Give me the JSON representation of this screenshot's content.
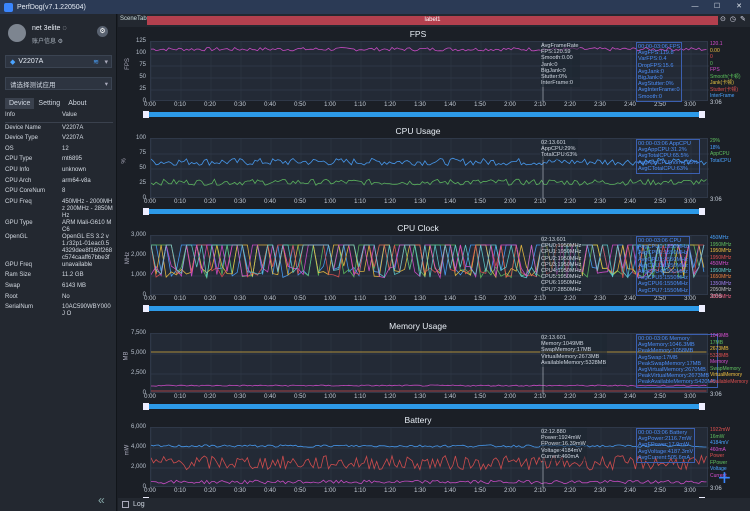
{
  "app": {
    "title": "PerfDog(v7.1.220504)",
    "window_controls": [
      "—",
      "☐",
      "✕"
    ]
  },
  "user": {
    "name": "net 3elite ◌",
    "info": "账户信息 ⚙"
  },
  "device": {
    "selected": "V2207A",
    "wifi_icon": "wifi-icon"
  },
  "app_select": {
    "placeholder": "请选择测试应用"
  },
  "tabs": [
    "Device",
    "Setting",
    "About"
  ],
  "info_table": {
    "header": [
      "Info",
      "Value"
    ],
    "rows": [
      [
        "Device Name",
        "V2207A"
      ],
      [
        "Device Type",
        "V2207A"
      ],
      [
        "OS",
        "12"
      ],
      [
        "CPU Type",
        "mt6895"
      ],
      [
        "CPU Info",
        "unknown"
      ],
      [
        "CPU Arch",
        "arm64-v8a"
      ],
      [
        "CPU CoreNum",
        "8"
      ],
      [
        "CPU Freq",
        "450MHz - 2000MHz 200MHz - 2850MHz"
      ],
      [
        "GPU Type",
        "ARM Mali-G610 MC6"
      ],
      [
        "OpenGL",
        "OpenGL ES 3.2 v1.r32p1-01eac0.5 4329dee8f160f268 c574caaff67bbe3f"
      ],
      [
        "GPU Freq",
        "unavailable"
      ],
      [
        "Ram Size",
        "11.2 GB"
      ],
      [
        "Swap",
        "6143 MB"
      ],
      [
        "Root",
        "No"
      ],
      [
        "SerialNum",
        "10AC590WBY000J O"
      ]
    ]
  },
  "scene": {
    "tab": "SceneTab",
    "label": "label1"
  },
  "x_ticks": [
    "0:00",
    "0:10",
    "0:20",
    "0:30",
    "0:40",
    "0:50",
    "1:00",
    "1:10",
    "1:20",
    "1:30",
    "1:40",
    "1:50",
    "2:00",
    "2:10",
    "2:20",
    "2:30",
    "2:40",
    "2:50",
    "3:00"
  ],
  "end_time": "3:06",
  "log_label": "Log",
  "panels": [
    {
      "title": "FPS",
      "ylabel": "FPS",
      "yticks": [
        "125",
        "100",
        "75",
        "50",
        "25",
        "0"
      ],
      "stat": [
        "AvgFrameRate",
        "FPS:120.59",
        "Smooth:0.00",
        "Jank:0",
        "BigJank:0",
        "Stutter:0%",
        "InterFrame:0"
      ],
      "stat2": [
        "00:00-03:06 FPS",
        "AvgFPS:119.8",
        "VarFPS:0.4",
        "DropFPS:15.6",
        "AvgJank:0",
        "BigJank:0",
        "AvgStutter:0%",
        "AvgInterFrame:0",
        "Smooth:0"
      ],
      "legend": [
        [
          "120.1",
          "#d74fd0"
        ],
        [
          "0.00",
          "#f0c040"
        ],
        [
          "0",
          "#e05050"
        ],
        [
          "0",
          "#60c060"
        ],
        [
          "FPS",
          "#d74fd0"
        ],
        [
          "Smooth(卡顿)",
          "#5ac05a"
        ],
        [
          "Jank(卡顿)",
          "#e0c040"
        ],
        [
          "Stutter(卡顿)",
          "#e05050"
        ],
        [
          "InterFrame",
          "#4aa3ff"
        ]
      ]
    },
    {
      "title": "CPU Usage",
      "ylabel": "%",
      "yticks": [
        "100",
        "75",
        "50",
        "25",
        "0"
      ],
      "stat": [
        "02:13.601",
        "AppCPU:29%",
        "TotalCPU:63%"
      ],
      "stat2": [
        "00:00-03:06 AppCPU",
        "AvgAppCPU:31.2%",
        "AvgTotalCPU:65.5%",
        "AvgAppCPU[norm]:25%",
        "AvgCTotalCPU:63%"
      ],
      "legend": [
        [
          "29%",
          "#60c060"
        ],
        [
          "18%",
          "#4aa3ff"
        ],
        [
          "AppCPU",
          "#60c060"
        ],
        [
          "TotalCPU",
          "#4aa3ff"
        ]
      ]
    },
    {
      "title": "CPU Clock",
      "ylabel": "MHz",
      "yticks": [
        "3,000",
        "2,000",
        "1,000",
        "0"
      ],
      "stat": [
        "02:13.601",
        "CPU0:1950MHz",
        "CPU1:1950MHz",
        "CPU2:1950MHz",
        "CPU3:1950MHz",
        "CPU4:1950MHz",
        "CPU5:1950MHz",
        "CPU6:1950MHz",
        "CPU7:2850MHz"
      ],
      "stat2": [
        "00:00-03:06 CPU",
        "AvgCPU0:1550MHz",
        "AvgCPU1:1550MHz",
        "AvgCPU2:1550MHz",
        "AvgCPU3:1550MHz",
        "AvgCPU4:1550MHz",
        "AvgCPU5:1550MHz",
        "AvgCPU6:1550MHz",
        "AvgCPU7:1550MHz"
      ],
      "legend": [
        [
          "450MHz",
          "#4aa3ff"
        ],
        [
          "1950MHz",
          "#60c060"
        ],
        [
          "1950MHz",
          "#f0c040"
        ],
        [
          "1950MHz",
          "#e05050"
        ],
        [
          "450MHz",
          "#d74fd0"
        ],
        [
          "1950MHz",
          "#60d0d0"
        ],
        [
          "1650MHz",
          "#f08040"
        ],
        [
          "1350MHz",
          "#a080f0"
        ],
        [
          "2050MHz",
          "#c0c0c0"
        ],
        [
          "2850MHz",
          "#f06080"
        ]
      ]
    },
    {
      "title": "Memory Usage",
      "ylabel": "MB",
      "yticks": [
        "7,500",
        "5,000",
        "2,500",
        "0"
      ],
      "stat": [
        "02:13.601",
        "Memory:1049MB",
        "SwapMemory:17MB",
        "VirtualMemory:2673MB",
        "AvailableMemory:5328MB"
      ],
      "stat2": [
        "00:00-03:06 Memory",
        "AvgMemory:1046.3MB",
        "PeakMemory:1058MB",
        "AvgSwap:17MB",
        "PeakSwapMemory:17MB",
        "AvgVirtualMemory:2670MB",
        "PeakVirtualMemory:2673MB",
        "PeakAvailableMemory:5420MB"
      ],
      "legend": [
        [
          "1049MB",
          "#d74fd0"
        ],
        [
          "17MB",
          "#60c060"
        ],
        [
          "2673MB",
          "#f0c040"
        ],
        [
          "5328MB",
          "#e05050"
        ],
        [
          "Memory",
          "#d74fd0"
        ],
        [
          "SwapMemory",
          "#60c060"
        ],
        [
          "VirtualMemory",
          "#f0c040"
        ],
        [
          "AvailableMemory",
          "#e05050"
        ]
      ]
    },
    {
      "title": "Battery",
      "ylabel": "mW",
      "yticks": [
        "6,000",
        "4,000",
        "2,000",
        "0"
      ],
      "stat": [
        "02:12.880",
        "Power:1924mW",
        "FPower:16.39mW",
        "Voltage:4184mV",
        "Current:460mA"
      ],
      "stat2": [
        "00:00-03:06 Battery",
        "AvgPower:2116.7mW",
        "AvgFPower:17.9mW",
        "AvgVoltage:4187.3mV",
        "AvgCurrent:505.6mA"
      ],
      "legend": [
        [
          "1922mW",
          "#e05050"
        ],
        [
          "16mW",
          "#60c060"
        ],
        [
          "4184mV",
          "#4aa3ff"
        ],
        [
          "460mA",
          "#d74fd0"
        ],
        [
          "Power",
          "#e05050"
        ],
        [
          "FPower",
          "#60c060"
        ],
        [
          "Voltage",
          "#4aa3ff"
        ],
        [
          "Current",
          "#d74fd0"
        ]
      ]
    }
  ],
  "colors": {
    "accent": "#3a86ff",
    "label_bg": "#b3404e"
  }
}
